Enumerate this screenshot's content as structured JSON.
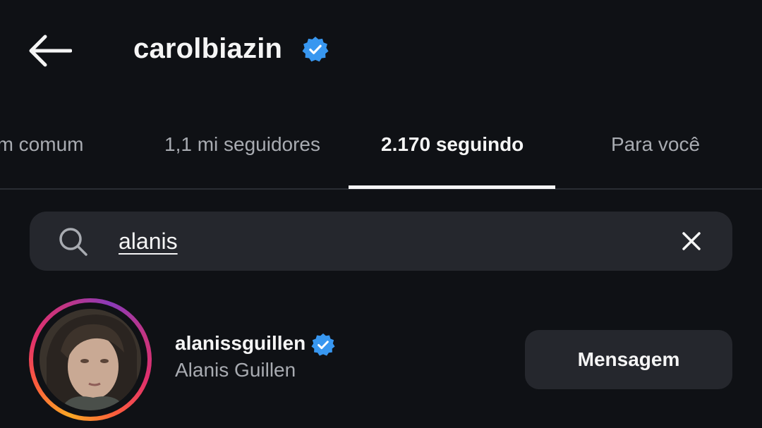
{
  "header": {
    "title": "carolbiazin",
    "back_icon": "arrow-left-icon",
    "verified_icon": "verified-badge-icon"
  },
  "tabs": [
    {
      "label": "em comum",
      "active": false
    },
    {
      "label": "1,1 mi seguidores",
      "active": false
    },
    {
      "label": "2.170 seguindo",
      "active": true
    },
    {
      "label": "Para você",
      "active": false
    }
  ],
  "search": {
    "value": "alanis",
    "placeholder": "",
    "search_icon": "search-icon",
    "clear_icon": "close-icon"
  },
  "results": [
    {
      "username": "alanissguillen",
      "full_name": "Alanis Guillen",
      "verified": true,
      "action_label": "Mensagem"
    }
  ],
  "colors": {
    "background": "#0f1115",
    "surface": "#25272d",
    "text_primary": "#f5f5f5",
    "text_secondary": "#a8abb1",
    "verified_blue": "#3897f0"
  }
}
